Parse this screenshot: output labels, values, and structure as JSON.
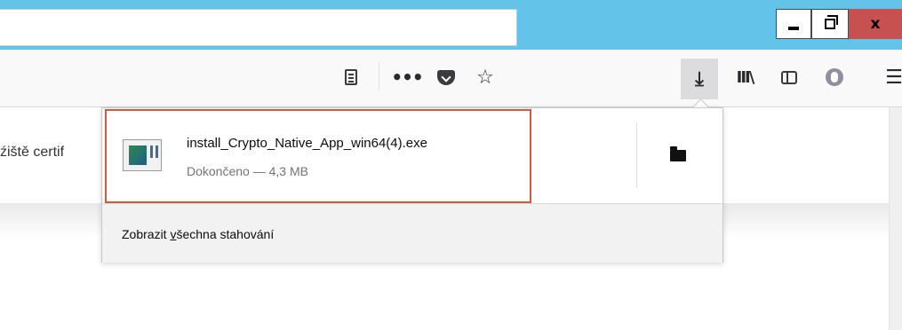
{
  "window": {
    "close_glyph": "x",
    "minimize_icon": "minimize-icon",
    "maximize_icon": "restore-icon"
  },
  "toolbar": {
    "icons": [
      "reader-view-icon",
      "more-actions-icon",
      "pocket-icon",
      "bookmark-star-icon",
      "download-icon",
      "library-icon",
      "sidebar-icon",
      "account-icon",
      "hamburger-menu-icon"
    ],
    "dots_glyph": "•••",
    "star_glyph": "☆",
    "download_glyph": "⤓",
    "library_glyph": "III\\",
    "menu_glyph": "☰"
  },
  "page": {
    "partial_text": "źiště certif"
  },
  "downloads_panel": {
    "item": {
      "file_name": "install_Crypto_Native_App_win64(4).exe",
      "status": "Dokončeno — 4,3 MB",
      "highlight_color": "#d05a3c"
    },
    "show_all_label_prefix": "Zobrazit ",
    "show_all_label_accesskey": "v",
    "show_all_label_suffix": "šechna stahování"
  },
  "colors": {
    "titlebar": "#63c3e9",
    "close_button": "#c75050"
  }
}
